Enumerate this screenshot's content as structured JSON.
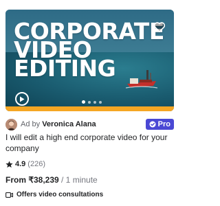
{
  "thumbnail": {
    "title_lines": [
      "CORPORATE",
      "VIDEO",
      "EDITING"
    ],
    "accent_color": "#f5a623",
    "icons": {
      "favorite": "heart-icon",
      "play": "play-icon"
    },
    "slide_dots": 4,
    "active_slide": 1
  },
  "seller": {
    "prefix": "Ad by",
    "name": "Veronica Alana",
    "badge": "Pro",
    "badge_color": "#4a48d4"
  },
  "gig": {
    "title": "I will edit a high end corporate video for your company"
  },
  "rating": {
    "value": "4.9",
    "count": "(226)",
    "icon": "star-icon"
  },
  "price": {
    "from": "From ₹38,239",
    "unit": "/ 1 minute"
  },
  "consultation": {
    "label": "Offers video consultations",
    "icon": "video-icon"
  }
}
